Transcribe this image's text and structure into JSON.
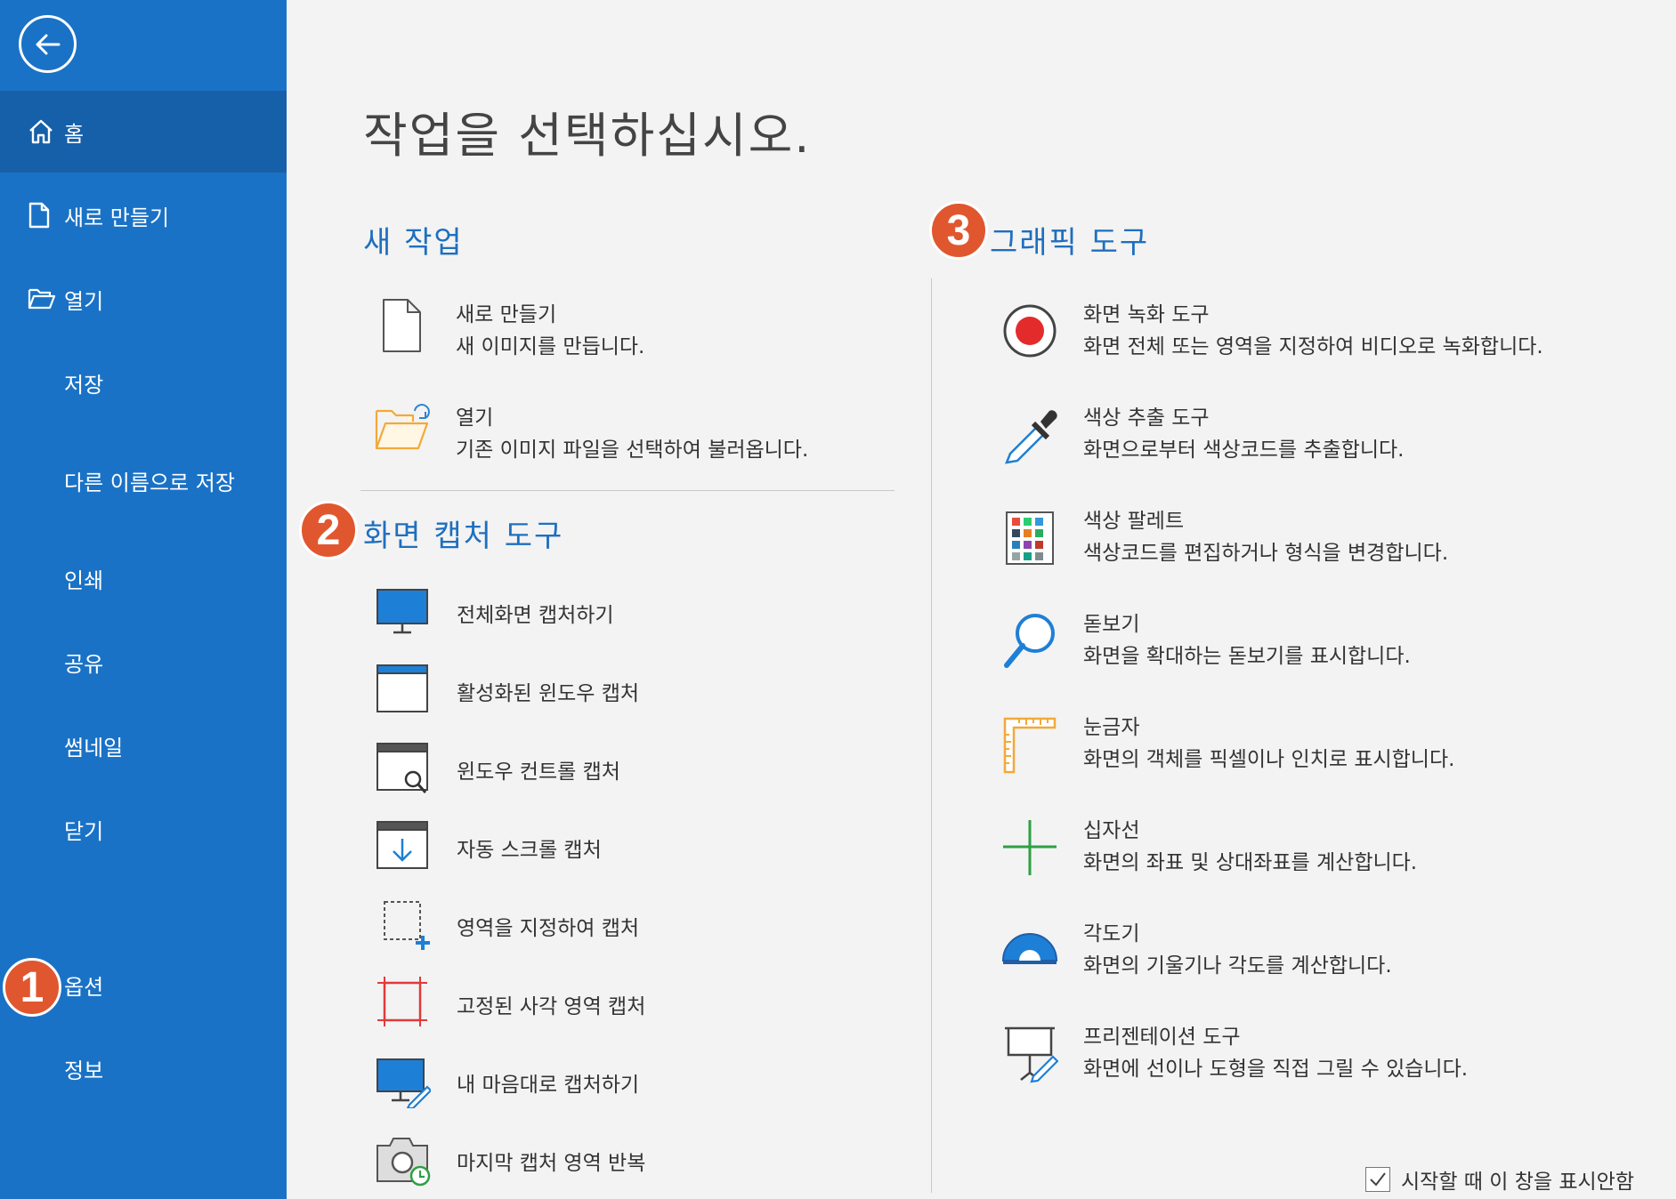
{
  "sidebar": {
    "items": [
      {
        "label": "홈",
        "icon": "home-icon",
        "active": true
      },
      {
        "label": "새로 만들기",
        "icon": "new-file-icon"
      },
      {
        "label": "열기",
        "icon": "open-folder-icon"
      },
      {
        "label": "저장"
      },
      {
        "label": "다른 이름으로 저장"
      },
      {
        "label": "인쇄"
      },
      {
        "label": "공유"
      },
      {
        "label": "썸네일"
      },
      {
        "label": "닫기"
      },
      {
        "label": "옵션"
      },
      {
        "label": "정보"
      }
    ]
  },
  "badges": [
    "1",
    "2",
    "3"
  ],
  "main": {
    "title": "작업을 선택하십시오.",
    "new_task": {
      "title": "새 작업",
      "items": [
        {
          "title": "새로 만들기",
          "desc": "새 이미지를 만듭니다.",
          "icon": "new-document-icon"
        },
        {
          "title": "열기",
          "desc": "기존 이미지 파일을 선택하여 불러옵니다.",
          "icon": "open-folder-icon"
        }
      ]
    },
    "capture": {
      "title": "화면 캡처 도구",
      "items": [
        {
          "label": "전체화면 캡처하기",
          "icon": "monitor-icon"
        },
        {
          "label": "활성화된 윈도우 캡처",
          "icon": "window-icon"
        },
        {
          "label": "윈도우 컨트롤 캡처",
          "icon": "window-search-icon"
        },
        {
          "label": "자동 스크롤 캡처",
          "icon": "scroll-down-icon"
        },
        {
          "label": "영역을 지정하여 캡처",
          "icon": "region-select-icon"
        },
        {
          "label": "고정된 사각 영역 캡처",
          "icon": "fixed-rect-icon"
        },
        {
          "label": "내 마음대로 캡처하기",
          "icon": "freehand-icon"
        },
        {
          "label": "마지막 캡처 영역 반복",
          "icon": "camera-repeat-icon"
        }
      ]
    },
    "graphic": {
      "title": "그래픽 도구",
      "items": [
        {
          "title": "화면 녹화 도구",
          "desc": "화면 전체 또는 영역을 지정하여 비디오로 녹화합니다.",
          "icon": "record-icon"
        },
        {
          "title": "색상 추출 도구",
          "desc": "화면으로부터 색상코드를 추출합니다.",
          "icon": "eyedropper-icon"
        },
        {
          "title": "색상 팔레트",
          "desc": "색상코드를 편집하거나 형식을 변경합니다.",
          "icon": "palette-icon"
        },
        {
          "title": "돋보기",
          "desc": "화면을 확대하는 돋보기를 표시합니다.",
          "icon": "magnifier-icon"
        },
        {
          "title": "눈금자",
          "desc": "화면의 객체를 픽셀이나 인치로 표시합니다.",
          "icon": "ruler-icon"
        },
        {
          "title": "십자선",
          "desc": "화면의 좌표 및 상대좌표를 계산합니다.",
          "icon": "crosshair-icon"
        },
        {
          "title": "각도기",
          "desc": "화면의 기울기나 각도를 계산합니다.",
          "icon": "protractor-icon"
        },
        {
          "title": "프리젠테이션 도구",
          "desc": "화면에 선이나 도형을 직접 그릴 수 있습니다.",
          "icon": "presentation-icon"
        }
      ]
    }
  },
  "startup_checkbox": {
    "label": "시작할 때 이 창을 표시안함",
    "checked": true
  },
  "colors": {
    "sidebar": "#1a72c6",
    "sidebar_active": "#1660aa",
    "accent": "#1f6fbf",
    "badge": "#e0572f"
  }
}
